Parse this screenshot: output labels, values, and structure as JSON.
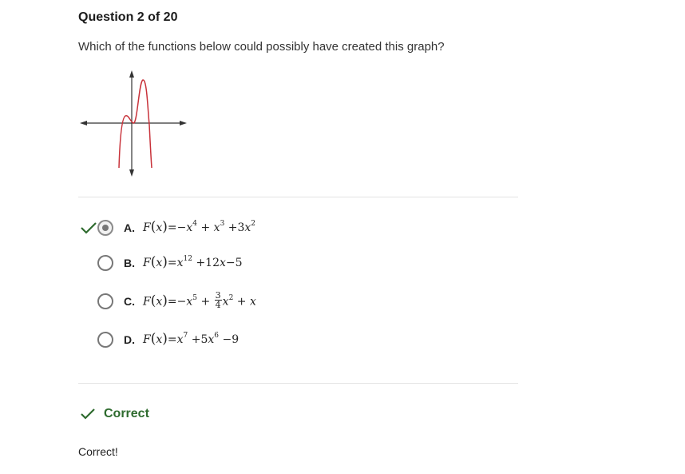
{
  "question": {
    "title": "Question 2 of 20",
    "prompt": "Which of the functions below could possibly have created this graph?"
  },
  "graph": {
    "type": "function-plot",
    "curve_color": "#c8323a",
    "axis_color": "#333333",
    "icons": [
      "axis-arrow-icon"
    ]
  },
  "choices": [
    {
      "letter": "A.",
      "selected": true,
      "marked_correct": true,
      "parts": {
        "fn": "F",
        "lp": "(",
        "var": "x",
        "rp": ")",
        "eq": "=−",
        "t1": "x",
        "e1": "4",
        "op1": " + ",
        "t2": "x",
        "e2": "3",
        "op2": " +3",
        "t3": "x",
        "e3": "2"
      }
    },
    {
      "letter": "B.",
      "selected": false,
      "parts": {
        "fn": "F",
        "lp": "(",
        "var": "x",
        "rp": ")",
        "eq": "=",
        "t1": "x",
        "e1": "12",
        "op1": " +12",
        "t2": "x",
        "op2": "−5"
      }
    },
    {
      "letter": "C.",
      "selected": false,
      "parts": {
        "fn": "F",
        "lp": "(",
        "var": "x",
        "rp": ")",
        "eq": "=−",
        "t1": "x",
        "e1": "5",
        "op1": " + ",
        "num": "3",
        "den": "4",
        "t2": "x",
        "e2": "2",
        "op2": " + ",
        "t3": "x"
      }
    },
    {
      "letter": "D.",
      "selected": false,
      "parts": {
        "fn": "F",
        "lp": "(",
        "var": "x",
        "rp": ")",
        "eq": "=",
        "t1": "x",
        "e1": "7",
        "op1": " +5",
        "t2": "x",
        "e2": "6",
        "op2": " −9"
      }
    }
  ],
  "feedback": {
    "status": "Correct",
    "status_color": "#2e6b2e",
    "icon": "checkmark-icon",
    "explanation": "Correct!"
  }
}
